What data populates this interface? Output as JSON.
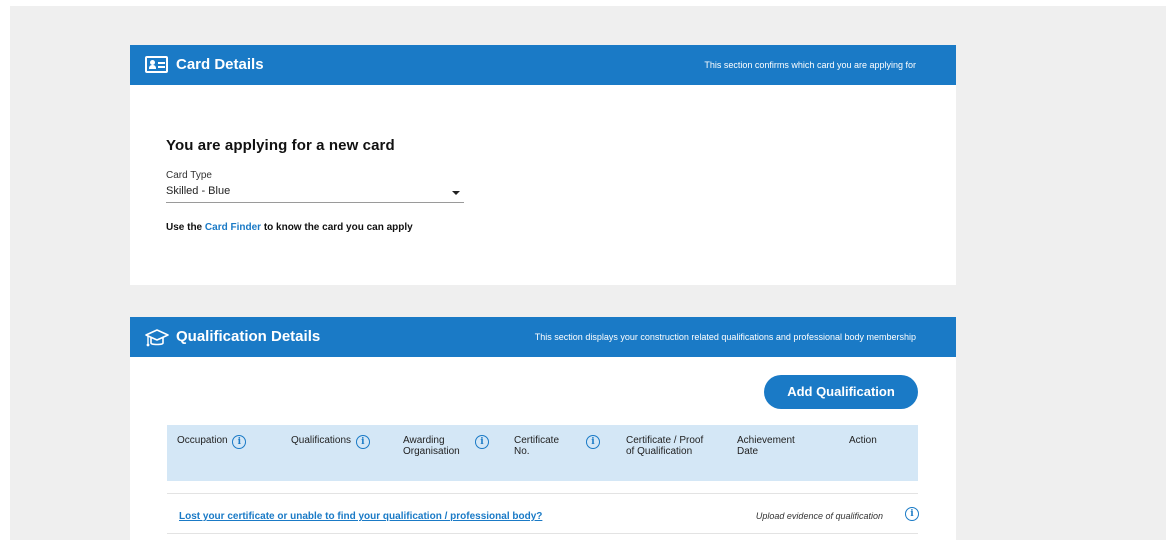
{
  "card_details": {
    "title": "Card Details",
    "subtitle": "This section confirms which card you are applying for",
    "heading": "You are applying for a new card",
    "card_type_label": "Card Type",
    "card_type_value": "Skilled - Blue",
    "finder_prefix": "Use the",
    "finder_link": "Card Finder",
    "finder_suffix": "to know the card you can apply"
  },
  "qualification_details": {
    "title": "Qualification Details",
    "subtitle": "This section displays your construction related qualifications and professional body membership",
    "add_button": "Add Qualification",
    "columns": [
      {
        "label": "Occupation"
      },
      {
        "label": "Qualifications"
      },
      {
        "label": "Awarding Organisation"
      },
      {
        "label": "Certificate No."
      },
      {
        "label": "Certificate / Proof of Qualification"
      },
      {
        "label": "Achievement Date"
      },
      {
        "label": "Action"
      }
    ],
    "lost_link": "Lost your certificate or unable to find your qualification / professional body?",
    "upload_text": "Upload evidence of qualification",
    "info_glyph": "i"
  },
  "colors": {
    "brand_blue": "#1a7ac6",
    "table_header_bg": "#d4e7f6",
    "page_bg": "#efefef"
  },
  "icons": {
    "card_details": "id-card-icon",
    "qualification_details": "graduation-cap-icon",
    "info": "info-icon",
    "dropdown": "caret-down-icon"
  }
}
